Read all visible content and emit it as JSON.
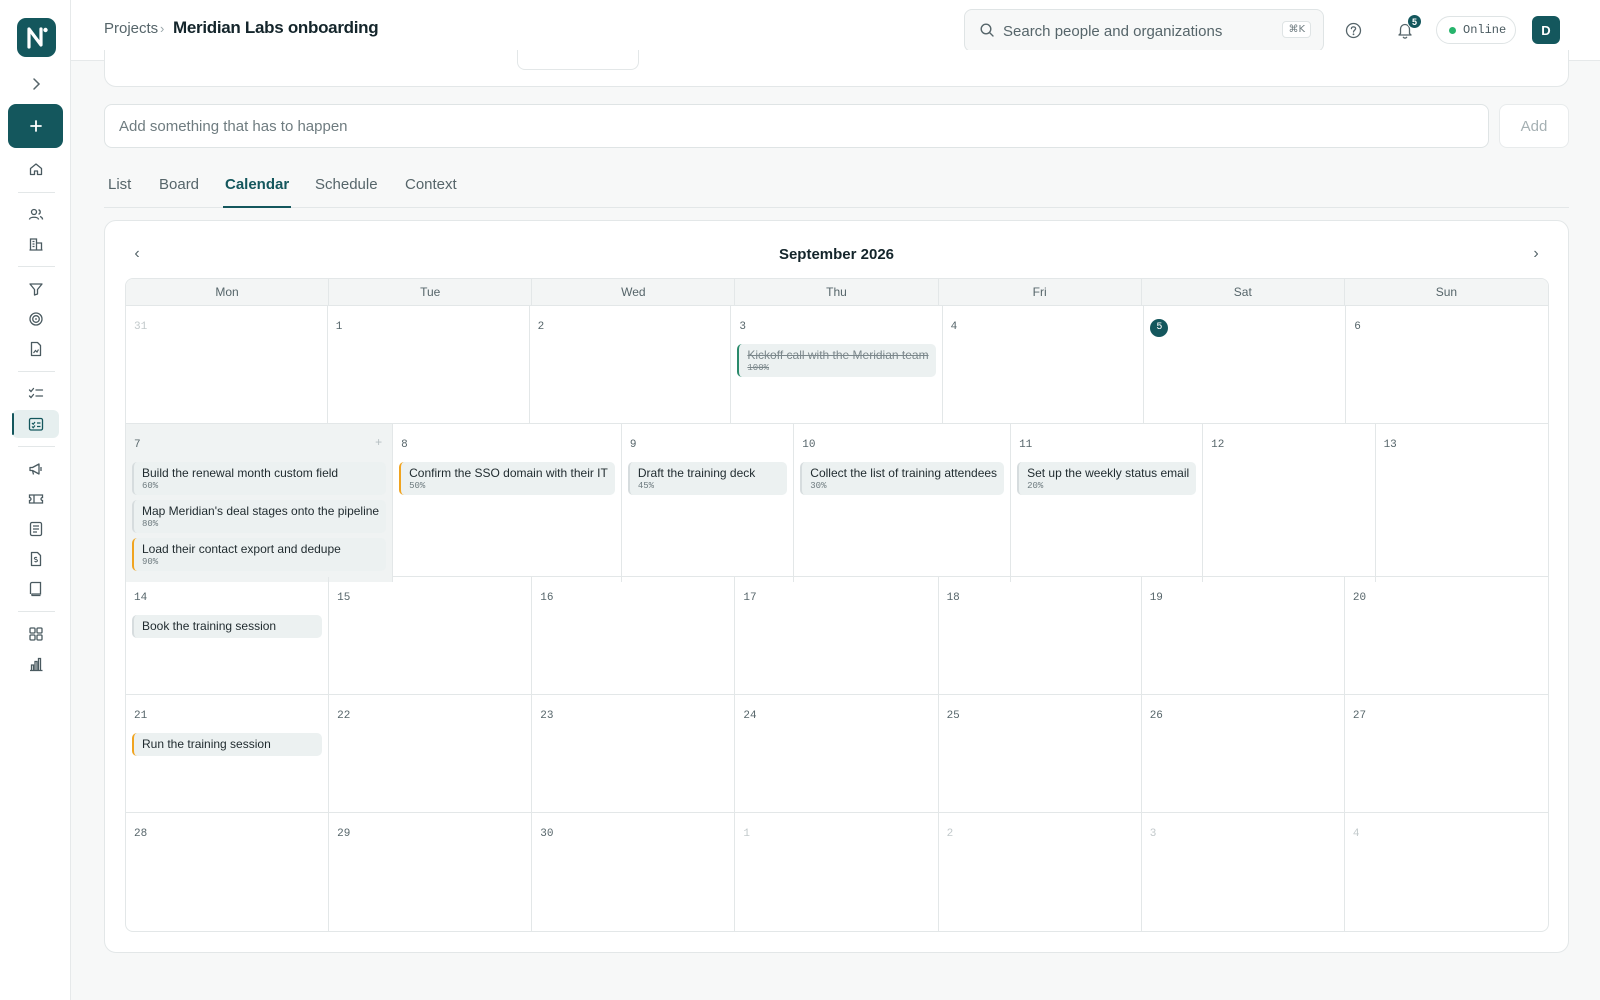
{
  "header": {
    "breadcrumb": "Projects",
    "breadcrumb_sep": "›",
    "title": "Meridian Labs onboarding",
    "search_placeholder": "Search people and organizations",
    "search_shortcut": "⌘K",
    "notification_count": "5",
    "status": "Online",
    "avatar_initial": "D"
  },
  "composer": {
    "placeholder": "Add something that has to happen",
    "add_label": "Add"
  },
  "tabs": [
    "List",
    "Board",
    "Calendar",
    "Schedule",
    "Context"
  ],
  "active_tab": "Calendar",
  "calendar": {
    "month_label": "September 2026",
    "prev": "‹",
    "next": "›",
    "weekdays": [
      "Mon",
      "Tue",
      "Wed",
      "Thu",
      "Fri",
      "Sat",
      "Sun"
    ],
    "weeks": [
      [
        {
          "day": "31",
          "muted": true,
          "events": []
        },
        {
          "day": "1",
          "events": []
        },
        {
          "day": "2",
          "events": []
        },
        {
          "day": "3",
          "events": [
            {
              "title": "Kickoff call with the Meridian team",
              "pct": "100%",
              "accent": "green",
              "done": true
            }
          ]
        },
        {
          "day": "4",
          "events": []
        },
        {
          "day": "5",
          "today": true,
          "events": []
        },
        {
          "day": "6",
          "events": []
        }
      ],
      [
        {
          "day": "7",
          "selected": true,
          "plus": "+",
          "events": [
            {
              "title": "Build the renewal month custom field",
              "pct": "60%",
              "accent": "plain"
            },
            {
              "title": "Map Meridian's deal stages onto the pipeline",
              "pct": "80%",
              "accent": "plain"
            },
            {
              "title": "Load their contact export and dedupe",
              "pct": "90%",
              "accent": "orange"
            }
          ]
        },
        {
          "day": "8",
          "events": [
            {
              "title": "Confirm the SSO domain with their IT",
              "pct": "50%",
              "accent": "orange"
            }
          ]
        },
        {
          "day": "9",
          "events": [
            {
              "title": "Draft the training deck",
              "pct": "45%",
              "accent": "plain"
            }
          ]
        },
        {
          "day": "10",
          "events": [
            {
              "title": "Collect the list of training attendees",
              "pct": "30%",
              "accent": "plain"
            }
          ]
        },
        {
          "day": "11",
          "events": [
            {
              "title": "Set up the weekly status email",
              "pct": "20%",
              "accent": "plain"
            }
          ]
        },
        {
          "day": "12",
          "events": []
        },
        {
          "day": "13",
          "events": []
        }
      ],
      [
        {
          "day": "14",
          "events": [
            {
              "title": "Book the training session",
              "pct": "",
              "accent": "plain"
            }
          ]
        },
        {
          "day": "15",
          "events": []
        },
        {
          "day": "16",
          "events": []
        },
        {
          "day": "17",
          "events": []
        },
        {
          "day": "18",
          "events": []
        },
        {
          "day": "19",
          "events": []
        },
        {
          "day": "20",
          "events": []
        }
      ],
      [
        {
          "day": "21",
          "events": [
            {
              "title": "Run the training session",
              "pct": "",
              "accent": "orange"
            }
          ]
        },
        {
          "day": "22",
          "events": []
        },
        {
          "day": "23",
          "events": []
        },
        {
          "day": "24",
          "events": []
        },
        {
          "day": "25",
          "events": []
        },
        {
          "day": "26",
          "events": []
        },
        {
          "day": "27",
          "events": []
        }
      ],
      [
        {
          "day": "28",
          "events": []
        },
        {
          "day": "29",
          "events": []
        },
        {
          "day": "30",
          "events": []
        },
        {
          "day": "1",
          "muted": true,
          "events": []
        },
        {
          "day": "2",
          "muted": true,
          "events": []
        },
        {
          "day": "3",
          "muted": true,
          "events": []
        },
        {
          "day": "4",
          "muted": true,
          "events": []
        }
      ]
    ]
  },
  "sidebar_icons": [
    "chevron-right-icon",
    "plus-icon",
    "home-icon",
    "people-icon",
    "building-icon",
    "filter-icon",
    "target-icon",
    "report-icon",
    "checklist-icon",
    "calendar-task-icon",
    "megaphone-icon",
    "ticket-icon",
    "document-icon",
    "invoice-icon",
    "book-icon",
    "grid-icon",
    "bar-chart-icon"
  ],
  "colors": {
    "brand": "#14575d",
    "accent_orange": "#f0a420",
    "accent_green": "#2a8a6b",
    "online": "#27b46c"
  }
}
